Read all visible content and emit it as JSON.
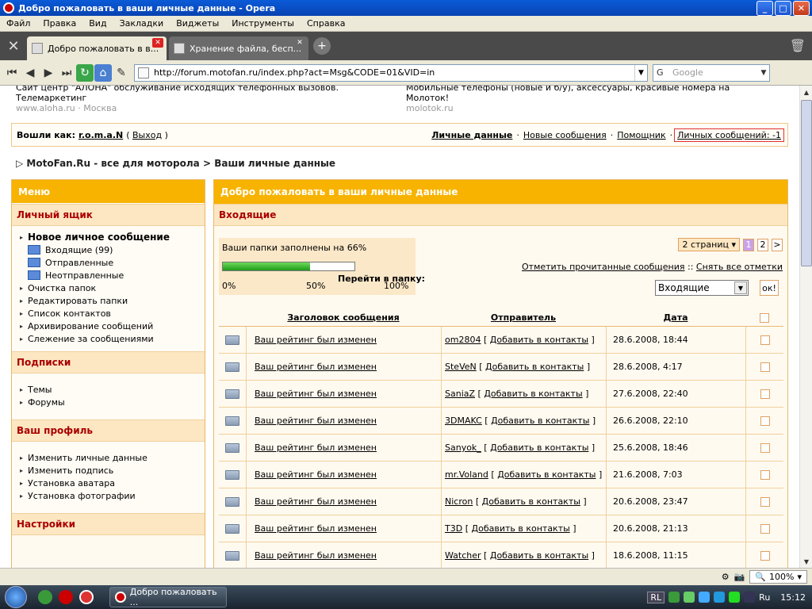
{
  "window": {
    "title": "Добро пожаловать в ваши личные данные - Opera",
    "controls": [
      "minimize-icon",
      "maximize-icon",
      "close-icon"
    ]
  },
  "menubar": [
    "Файл",
    "Правка",
    "Вид",
    "Закладки",
    "Виджеты",
    "Инструменты",
    "Справка"
  ],
  "tabs": [
    {
      "label": "Добро пожаловать в в...",
      "active": true
    },
    {
      "label": "Хранение файла, бесп...",
      "active": false
    }
  ],
  "address": {
    "url": "http://forum.motofan.ru/index.php?act=Msg&CODE=01&VID=in",
    "search_placeholder": "Google"
  },
  "ads": {
    "left": {
      "line1": "Сайт центр \"АЛОНА\" обслуживание исходящих телефонных вызовов.",
      "line2": "Телемаркетинг",
      "site": "www.aloha.ru",
      "dot": "·",
      "city": "Москва"
    },
    "right": {
      "line1": "Мобильные телефоны (новые и б/у), аксессуары, красивые номера на",
      "line2": "Молоток!",
      "site": "molotok.ru"
    }
  },
  "loginbar": {
    "logged_as": "Вошли как:",
    "username": "r.o.m.a.N",
    "open_paren": "(",
    "logout": "Выход",
    "close_paren": ")",
    "personal": "Личные данные",
    "new_messages": "Новые сообщения",
    "helper": "Помощник",
    "private_messages": "Личных сообщений: -1",
    "sep": "·"
  },
  "breadcrumb": {
    "arrow": "▷",
    "site": "MotoFan.Ru - все для моторола",
    "sep": ">",
    "page": "Ваши личные данные"
  },
  "leftmenu": {
    "title": "Меню",
    "sections": [
      {
        "title": "Личный ящик",
        "items": [
          {
            "label": "Новое личное сообщение",
            "bold": true
          },
          {
            "label": "Входящие (99)",
            "folder": true
          },
          {
            "label": "Отправленные",
            "folder": true
          },
          {
            "label": "Неотправленные",
            "folder": true
          },
          {
            "label": "Очистка папок"
          },
          {
            "label": "Редактировать папки"
          },
          {
            "label": "Список контактов"
          },
          {
            "label": "Архивирование сообщений"
          },
          {
            "label": "Слежение за сообщениями"
          }
        ]
      },
      {
        "title": "Подписки",
        "items": [
          {
            "label": "Темы"
          },
          {
            "label": "Форумы"
          }
        ]
      },
      {
        "title": "Ваш профиль",
        "items": [
          {
            "label": "Изменить личные данные"
          },
          {
            "label": "Изменить подпись"
          },
          {
            "label": "Установка аватара"
          },
          {
            "label": "Установка фотографии"
          }
        ]
      },
      {
        "title": "Настройки",
        "items": []
      }
    ]
  },
  "main": {
    "title": "Добро пожаловать в ваши личные данные",
    "subtitle": "Входящие",
    "fill": {
      "label": "Ваши папки заполнены на 66%",
      "percent": 66,
      "scale": [
        "0%",
        "50%",
        "100%"
      ]
    },
    "pager": {
      "select": "2 страниц",
      "pages": [
        "1",
        "2",
        ">"
      ],
      "current": "1"
    },
    "mark_read": "Отметить прочитанные сообщения",
    "mark_sep": "::",
    "unmark_all": "Снять все отметки",
    "goto_label": "Перейти в папку:",
    "goto_value": "Входящие",
    "ok": "ок!",
    "columns": {
      "subject": "Заголовок сообщения",
      "sender": "Отправитель",
      "date": "Дата"
    },
    "add_contact": "Добавить в контакты",
    "rows": [
      {
        "subject": "Ваш рейтинг был изменен",
        "sender": "om2804",
        "date": "28.6.2008, 18:44"
      },
      {
        "subject": "Ваш рейтинг был изменен",
        "sender": "SteVeN",
        "date": "28.6.2008, 4:17"
      },
      {
        "subject": "Ваш рейтинг был изменен",
        "sender": "SaniaZ",
        "date": "27.6.2008, 22:40"
      },
      {
        "subject": "Ваш рейтинг был изменен",
        "sender": "3DMAKC",
        "date": "26.6.2008, 22:10"
      },
      {
        "subject": "Ваш рейтинг был изменен",
        "sender": "Sanyok_",
        "date": "25.6.2008, 18:46"
      },
      {
        "subject": "Ваш рейтинг был изменен",
        "sender": "mr.Voland",
        "date": "21.6.2008, 7:03"
      },
      {
        "subject": "Ваш рейтинг был изменен",
        "sender": "Nicron",
        "date": "20.6.2008, 23:47"
      },
      {
        "subject": "Ваш рейтинг был изменен",
        "sender": "T3D",
        "date": "20.6.2008, 21:13"
      },
      {
        "subject": "Ваш рейтинг был изменен",
        "sender": "Watcher",
        "date": "18.6.2008, 11:15"
      }
    ]
  },
  "statusbar": {
    "zoom": "100%"
  },
  "taskbar": {
    "task": "Добро пожаловать ...",
    "lang": "RL",
    "lang2": "Ru",
    "time": "15:12"
  }
}
